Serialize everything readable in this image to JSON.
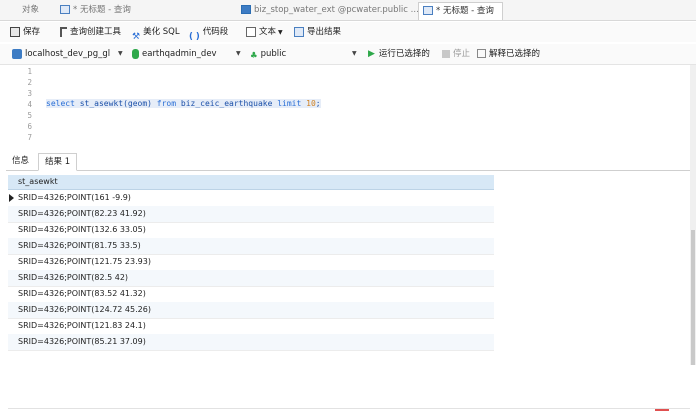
{
  "tabs": [
    {
      "label": "对象",
      "active": false
    },
    {
      "label": "* 无标题 - 查询",
      "active": false
    },
    {
      "label": "biz_stop_water_ext @pcwater.public ...",
      "active": false
    },
    {
      "label": "* 无标题 - 查询",
      "active": true
    }
  ],
  "toolbar": {
    "save": "保存",
    "query_builder": "查询创建工具",
    "beautify_sql": "美化 SQL",
    "code_snippet": "代码段",
    "text": "文本",
    "export_result": "导出结果"
  },
  "connection": {
    "server": "localhost_dev_pg_gl",
    "database": "earthqadmin_dev",
    "schema": "public",
    "run_selected": "运行已选择的",
    "stop": "停止",
    "explain_selected": "解释已选择的"
  },
  "editor": {
    "line_numbers": [
      "1",
      "2",
      "3",
      "4",
      "5",
      "6",
      "7"
    ],
    "sql_select": "select",
    "sql_mid": " st_asewkt(geom) ",
    "sql_from": "from",
    "sql_table": " biz_ceic_earthquake ",
    "sql_limit": "limit",
    "sql_num": " 10",
    "sql_end": ";"
  },
  "result_tabs": [
    {
      "label": "信息",
      "active": false
    },
    {
      "label": "结果 1",
      "active": true
    }
  ],
  "grid": {
    "column": "st_asewkt",
    "rows": [
      "SRID=4326;POINT(161 -9.9)",
      "SRID=4326;POINT(82.23 41.92)",
      "SRID=4326;POINT(132.6 33.05)",
      "SRID=4326;POINT(81.75 33.5)",
      "SRID=4326;POINT(121.75 23.93)",
      "SRID=4326;POINT(82.5 42)",
      "SRID=4326;POINT(83.52 41.32)",
      "SRID=4326;POINT(124.72 45.26)",
      "SRID=4326;POINT(121.83 24.1)",
      "SRID=4326;POINT(85.21 37.09)"
    ]
  },
  "colors": {
    "accent": "#2a6fd6",
    "header_bg": "#d7e8f6",
    "run_green": "#2ea84a"
  }
}
